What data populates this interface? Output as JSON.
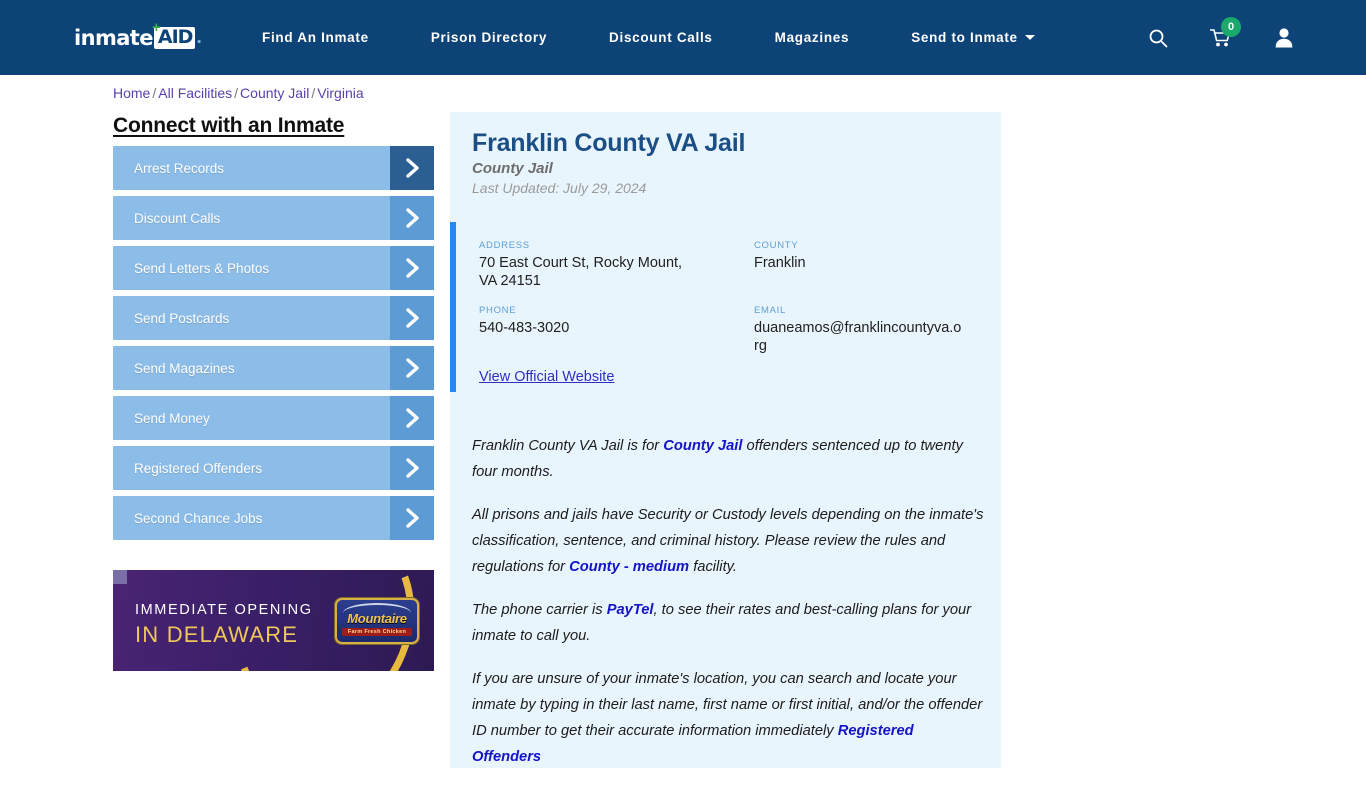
{
  "header": {
    "logo": {
      "primary": "inmate",
      "secondary": "AID",
      "plus": "+"
    },
    "nav": [
      {
        "label": "Find An Inmate",
        "has_caret": false
      },
      {
        "label": "Prison Directory",
        "has_caret": false
      },
      {
        "label": "Discount Calls",
        "has_caret": false
      },
      {
        "label": "Magazines",
        "has_caret": false
      },
      {
        "label": "Send to Inmate",
        "has_caret": true
      }
    ],
    "icons": {
      "search": "search-icon",
      "cart": "cart-icon",
      "cart_count": "0",
      "account": "user-icon"
    },
    "background_color": "#0e4377",
    "badge_color": "#18a96b"
  },
  "breadcrumb": {
    "items": [
      "Home",
      "All Facilities",
      "County Jail",
      "Virginia"
    ],
    "separator": "/"
  },
  "sidebar": {
    "title": "Connect with an Inmate",
    "items": [
      {
        "label": "Arrest Records",
        "active": true
      },
      {
        "label": "Discount Calls",
        "active": false
      },
      {
        "label": "Send Letters & Photos",
        "active": false
      },
      {
        "label": "Send Postcards",
        "active": false
      },
      {
        "label": "Send Magazines",
        "active": false
      },
      {
        "label": "Send Money",
        "active": false
      },
      {
        "label": "Registered Offenders",
        "active": false
      },
      {
        "label": "Second Chance Jobs",
        "active": false
      }
    ],
    "button_color": "#8cbce8",
    "arrow_color": "#5d9bd4",
    "arrow_active_color": "#2b5e93"
  },
  "ad": {
    "line1": "IMMEDIATE OPENING",
    "line2": "IN DELAWARE",
    "brand": "Mountaire",
    "brand_sub": "Farm Fresh Chicken",
    "background_color": "#3b1e66",
    "accent_color": "#e7b93f"
  },
  "facility": {
    "name": "Franklin County VA Jail",
    "type": "County Jail",
    "last_updated": "Last Updated: July 29, 2024",
    "fields": [
      {
        "label": "ADDRESS",
        "value": "70 East Court St, Rocky Mount, VA 24151"
      },
      {
        "label": "COUNTY",
        "value": "Franklin"
      },
      {
        "label": "PHONE",
        "value": "540-483-3020"
      },
      {
        "label": "EMAIL",
        "value": "duaneamos@franklincountyva.org"
      }
    ],
    "official_website_label": "View Official Website",
    "accent_color": "#1f8ceb",
    "card_background": "#e9f5fd"
  },
  "description": {
    "p1_a": "Franklin County VA Jail is for ",
    "p1_link": "County Jail",
    "p1_b": " offenders sentenced up to twenty four months.",
    "p2_a": "All prisons and jails have Security or Custody levels depending on the inmate's classification, sentence, and criminal history. Please review the rules and regulations for ",
    "p2_link": "County - medium",
    "p2_b": " facility.",
    "p3_a": "The phone carrier is ",
    "p3_link": "PayTel",
    "p3_b": ", to see their rates and best-calling plans for your inmate to call you.",
    "p4_a": "If you are unsure of your inmate's location, you can search and locate your inmate by typing in their last name, first name or first initial, and/or the offender ID number to get their accurate information immediately ",
    "p4_link": "Registered Offenders"
  }
}
